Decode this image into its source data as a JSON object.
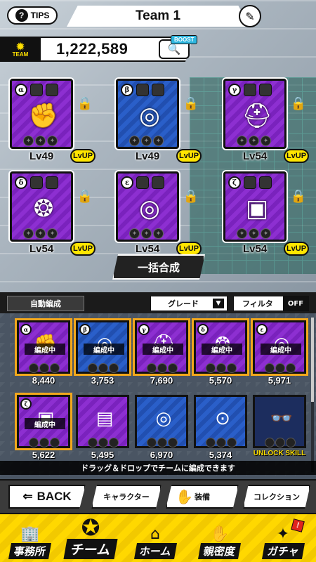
{
  "header": {
    "tips_label": "TIPS",
    "title": "Team 1",
    "edit_icon": "pencil-icon",
    "help_icon": "question-icon"
  },
  "team_power": {
    "badge_label": "TEAM",
    "value": "1,222,589",
    "boost_label": "BOOST",
    "boost_icon": "magnifier-icon"
  },
  "slots": [
    {
      "greek": "α",
      "level": "Lv49",
      "lvup": "LvUP",
      "item_icon": "glove-icon",
      "color": "purple"
    },
    {
      "greek": "β",
      "level": "Lv49",
      "lvup": "LvUP",
      "item_icon": "belt-icon",
      "color": "blue"
    },
    {
      "greek": "γ",
      "level": "Lv54",
      "lvup": "LvUP",
      "item_icon": "visor-icon",
      "color": "purple"
    },
    {
      "greek": "δ",
      "level": "Lv54",
      "lvup": "LvUP",
      "item_icon": "grenade-icon",
      "color": "purple"
    },
    {
      "greek": "ε",
      "level": "Lv54",
      "lvup": "LvUP",
      "item_icon": "belt-icon",
      "color": "purple"
    },
    {
      "greek": "ζ",
      "level": "Lv54",
      "lvup": "LvUP",
      "item_icon": "armor-icon",
      "color": "purple"
    }
  ],
  "merge_button": "一括合成",
  "filters": {
    "auto_label": "自動編成",
    "grade_label": "グレード",
    "filter_label": "フィルタ",
    "filter_state": "OFF"
  },
  "inventory": [
    {
      "greek": "α",
      "value": "8,440",
      "badge": "編成中",
      "color": "purple",
      "equipped": true
    },
    {
      "greek": "β",
      "value": "3,753",
      "badge": "編成中",
      "color": "blue",
      "equipped": true
    },
    {
      "greek": "γ",
      "value": "7,690",
      "badge": "編成中",
      "color": "purple",
      "equipped": true
    },
    {
      "greek": "δ",
      "value": "5,570",
      "badge": "編成中",
      "color": "purple",
      "equipped": true
    },
    {
      "greek": "ε",
      "value": "5,971",
      "badge": "編成中",
      "color": "purple",
      "equipped": true
    },
    {
      "greek": "ζ",
      "value": "5,622",
      "badge": "編成中",
      "color": "purple",
      "equipped": true
    },
    {
      "greek": "",
      "value": "5,495",
      "badge": "",
      "color": "purple",
      "equipped": false
    },
    {
      "greek": "",
      "value": "6,970",
      "badge": "",
      "color": "blue",
      "equipped": false
    },
    {
      "greek": "",
      "value": "5,374",
      "badge": "",
      "color": "blue",
      "equipped": false
    },
    {
      "greek": "",
      "value": "UNLOCK SKILL",
      "badge": "",
      "color": "plain",
      "equipped": false
    }
  ],
  "hint": "ドラッグ＆ドロップでチームに編成できます",
  "tabs": {
    "back_label": "BACK",
    "character": "キャラクター",
    "equipment": "装備",
    "collection": "コレクション"
  },
  "nav": [
    {
      "label": "事務所",
      "icon": "office-icon"
    },
    {
      "label": "チーム",
      "icon": "team-icon",
      "active": true
    },
    {
      "label": "ホーム",
      "icon": "home-icon"
    },
    {
      "label": "親密度",
      "icon": "handshake-icon"
    },
    {
      "label": "ガチャ",
      "icon": "gacha-icon",
      "alert": "!"
    }
  ]
}
